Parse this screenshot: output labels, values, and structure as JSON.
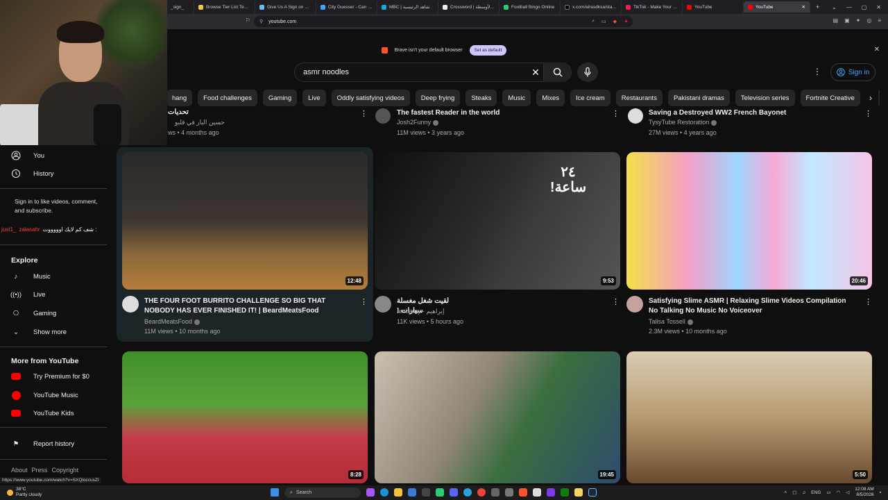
{
  "browser": {
    "tabs": [
      {
        "label": "_sign_",
        "color": "#8a8a8a"
      },
      {
        "label": "Browse Tier List Templa",
        "color": "#f4c542"
      },
      {
        "label": "Give Us A Sign on Steam",
        "color": "#1b2838"
      },
      {
        "label": "City Guesser - Can you",
        "color": "#3ea6ff"
      },
      {
        "label": "MBC | شاهد الرئيسية",
        "color": "#18a9d8"
      },
      {
        "label": "Crossword | لغز الأوسطة",
        "color": "#eeeeee"
      },
      {
        "label": "Football Bingo Online",
        "color": "#2ecc71"
      },
      {
        "label": "x.com/alrasdksa/status/",
        "color": "#111111"
      },
      {
        "label": "TikTok - Make Your Day",
        "color": "#ee1d52"
      },
      {
        "label": "YouTube",
        "color": "#ff0000"
      }
    ],
    "active_tab": "YouTube",
    "new_tab": "+",
    "url": "youtube.com",
    "notice_text": "Brave isn't your default browser",
    "notice_button": "Set as default"
  },
  "header": {
    "search_value": "asmr noodles",
    "signin_label": "Sign in"
  },
  "chips": [
    "hang",
    "Food challenges",
    "Gaming",
    "Live",
    "Oddly satisfying videos",
    "Deep frying",
    "Steaks",
    "Music",
    "Mixes",
    "Ice cream",
    "Restaurants",
    "Pakistani dramas",
    "Television series",
    "Fortnite Creative",
    "H"
  ],
  "sidebar": {
    "you": "You",
    "history": "History",
    "signin_note": "Sign in to like videos, comment, and subscribe.",
    "explore_heading": "Explore",
    "explore": [
      "Music",
      "Live",
      "Gaming",
      "Show more"
    ],
    "more_heading": "More from YouTube",
    "more": [
      "Try Premium for $0",
      "YouTube Music",
      "YouTube Kids"
    ],
    "report": "Report history",
    "footer": [
      "About",
      "Press",
      "Copyright"
    ]
  },
  "chat": {
    "user": "just1_",
    "user2": "zalasahr",
    "message": "شف كم لايك اوووووت :"
  },
  "top_row": [
    {
      "title": "تحديات",
      "channel": "حسين البار في قلبو",
      "meta": "ws • 4 months ago"
    },
    {
      "title": "The fastest Reader in the world",
      "channel": "Josh2Funny",
      "meta": "11M views • 3 years ago"
    },
    {
      "title": "Saving a Destroyed WW2 French Bayonet",
      "channel": "TysyTube Restoration",
      "meta": "27M views • 4 years ago"
    }
  ],
  "videos": [
    {
      "title": "THE FOUR FOOT BURRITO CHALLENGE SO BIG THAT NOBODY HAS EVER FINISHED IT! | BeardMeatsFood",
      "channel": "BeardMeatsFood",
      "meta": "11M views • 10 months ago",
      "duration": "12:48"
    },
    {
      "title": "لقيت شغل مغسلة سيارات !",
      "channel": "ambamy - إبراهيم",
      "meta": "11K views • 5 hours ago",
      "duration": "9:53",
      "overlay": "٢٤ ساعة!"
    },
    {
      "title": "Satisfying Slime ASMR | Relaxing Slime Videos Compilation No Talking No Music No Voiceover",
      "channel": "Talisa Tossell",
      "meta": "2.3M views • 10 months ago",
      "duration": "20:46"
    },
    {
      "title": "",
      "channel": "",
      "meta": "",
      "duration": "8:28"
    },
    {
      "title": "",
      "channel": "",
      "meta": "",
      "duration": "19:45"
    },
    {
      "title": "",
      "channel": "",
      "meta": "",
      "duration": "5:50"
    }
  ],
  "status_link": "https://www.youtube.com/watch?v=SXQloccusZI",
  "taskbar": {
    "temp": "38°C",
    "weather": "Partly cloudy",
    "search": "Search",
    "lang": "ENG",
    "time": "12:08 AM",
    "date": "8/5/2026"
  }
}
